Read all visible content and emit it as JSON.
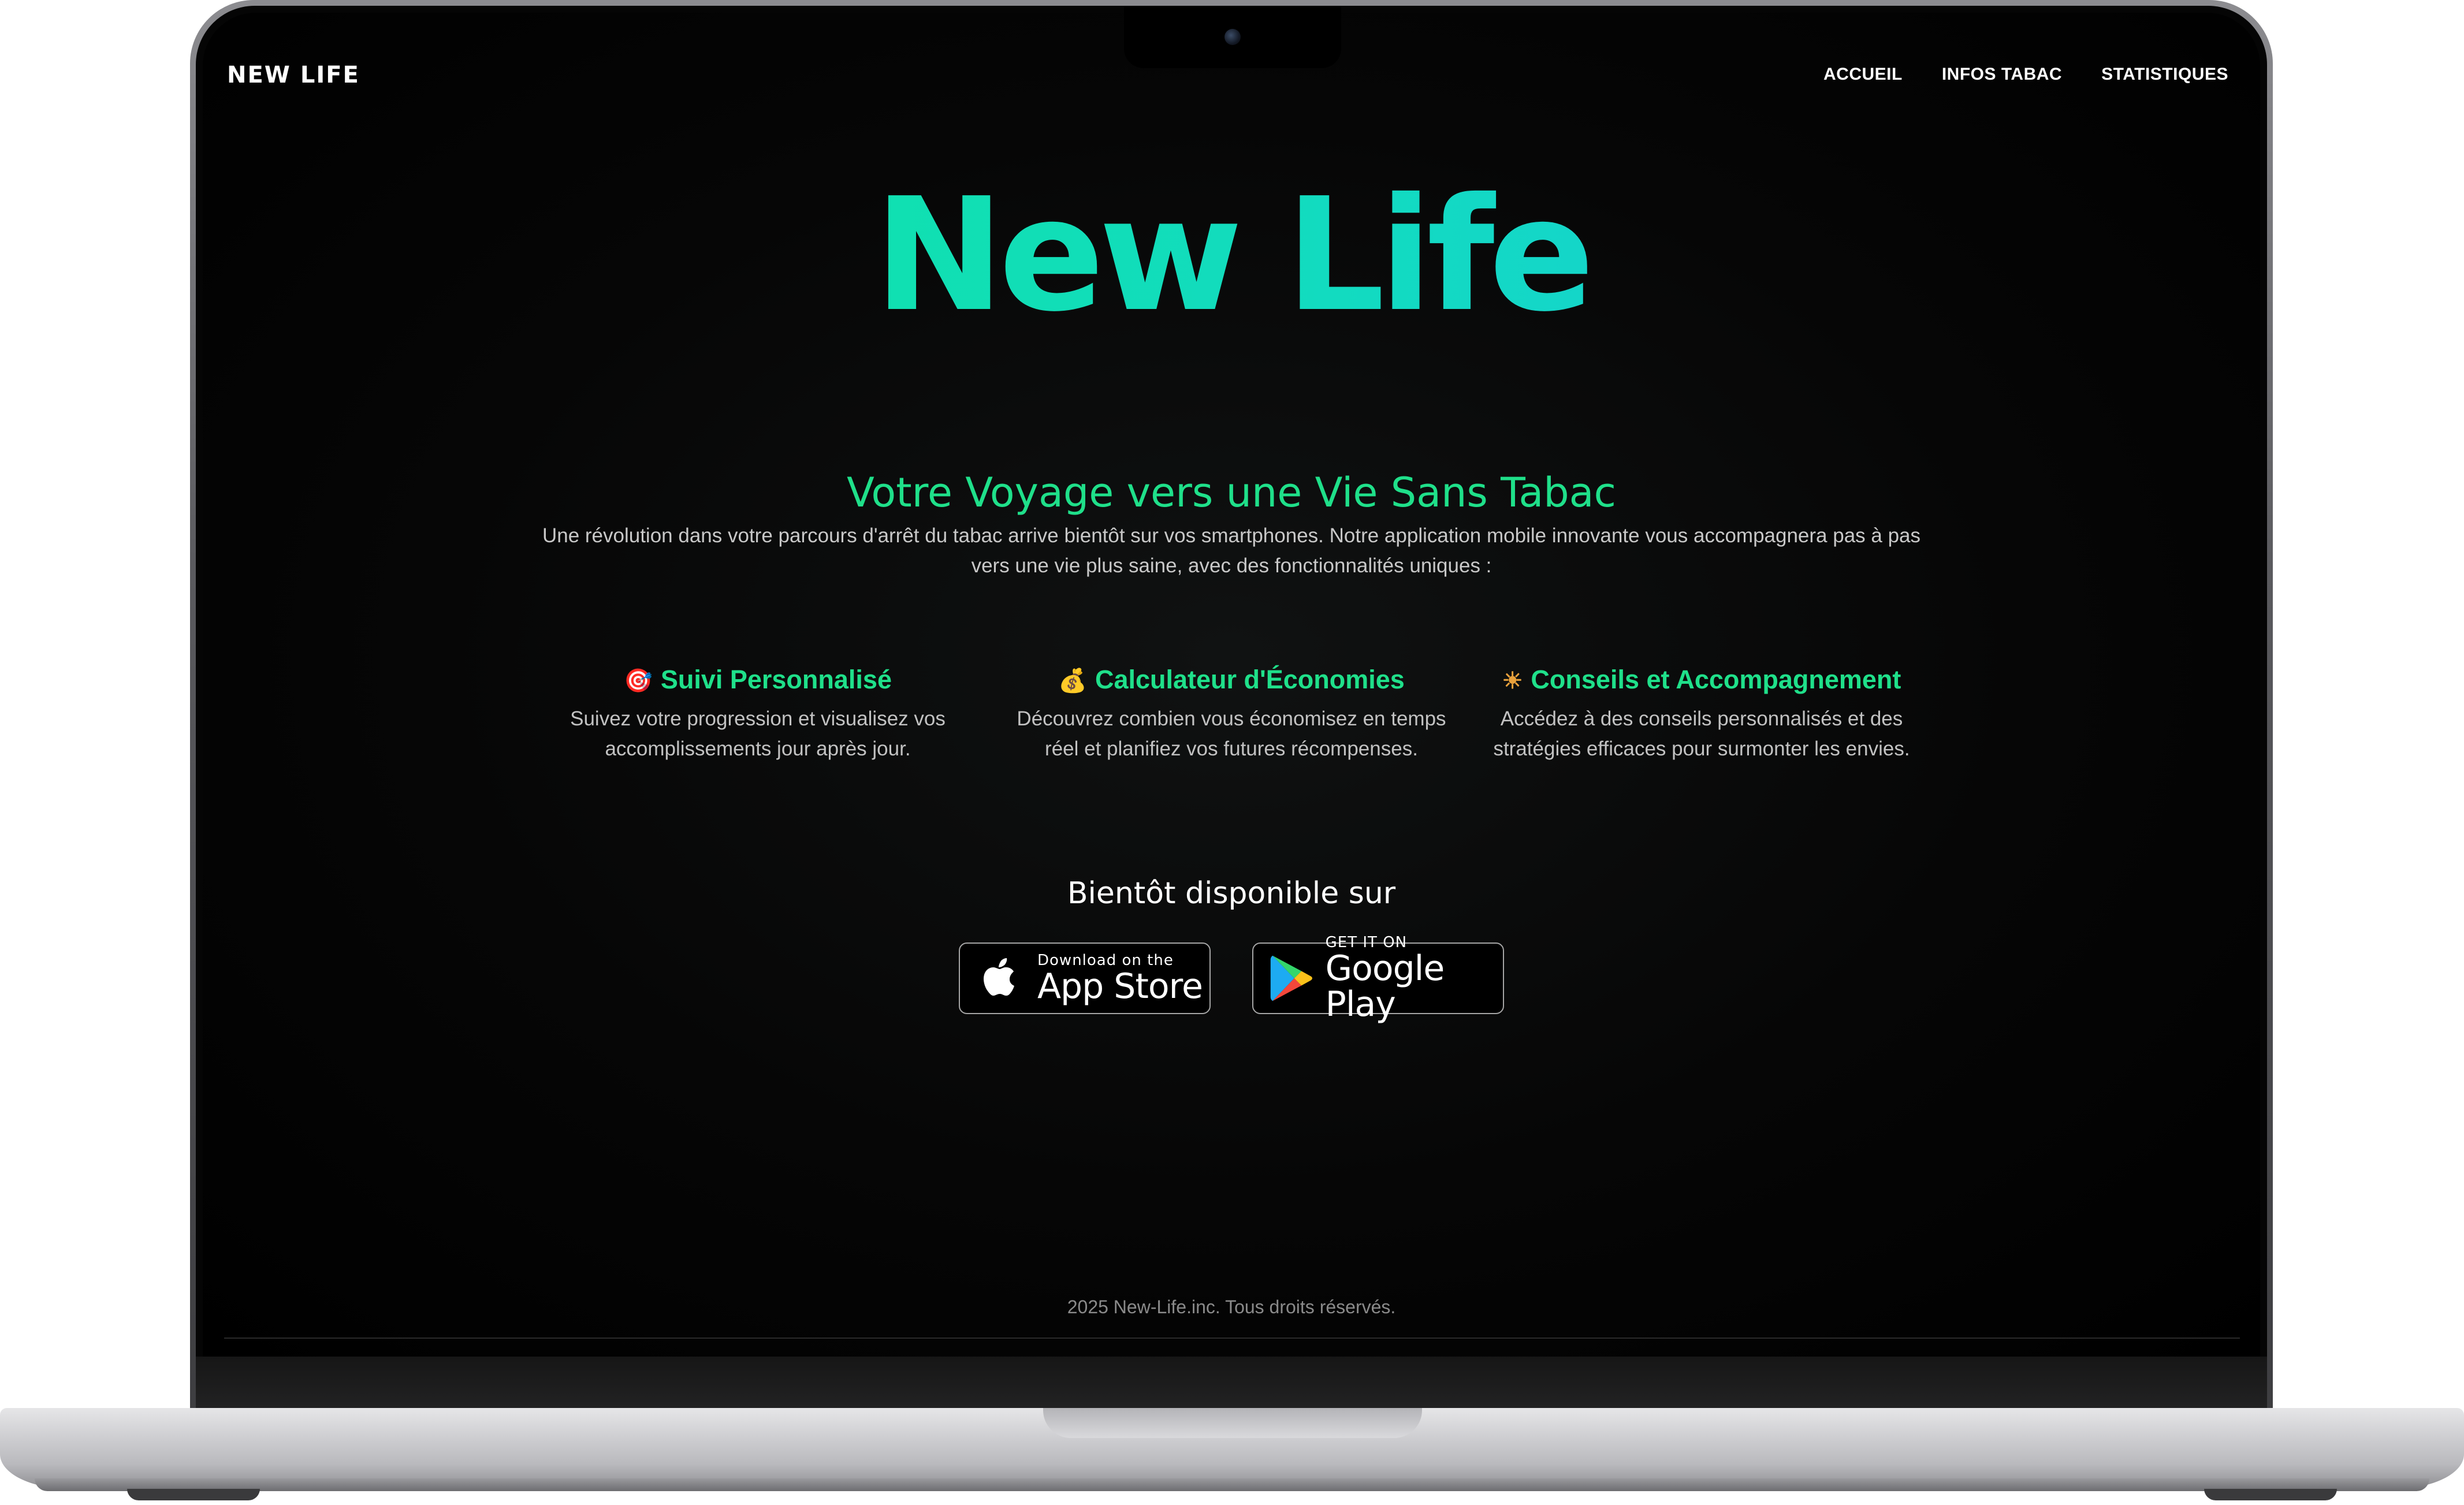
{
  "header": {
    "brand": "NEW LIFE",
    "nav": [
      {
        "label": "ACCUEIL"
      },
      {
        "label": "INFOS TABAC"
      },
      {
        "label": "STATISTIQUES"
      }
    ]
  },
  "hero": {
    "title": "New Life",
    "subtitle": "Votre Voyage vers une Vie Sans Tabac",
    "intro": "Une révolution dans votre parcours d'arrêt du tabac arrive bientôt sur vos smartphones. Notre application mobile innovante vous accompagnera pas à pas vers une vie plus saine, avec des fonctionnalités uniques :"
  },
  "features": [
    {
      "icon": "target-icon",
      "emoji": "🎯",
      "title": "Suivi Personnalisé",
      "description": "Suivez votre progression et visualisez vos accomplissements jour après jour."
    },
    {
      "icon": "money-bag-icon",
      "emoji": "💰",
      "title": "Calculateur d'Économies",
      "description": "Découvrez combien vous économisez en temps réel et planifiez vos futures récompenses."
    },
    {
      "icon": "sun-icon",
      "emoji": "☀",
      "title": "Conseils et Accompagnement",
      "description": "Accédez à des conseils personnalisés et des stratégies efficaces pour surmonter les envies."
    }
  ],
  "download": {
    "heading": "Bientôt disponible sur",
    "app_store": {
      "small": "Download on the",
      "big": "App Store"
    },
    "google_play": {
      "small": "GET IT ON",
      "big": "Google Play"
    }
  },
  "footer": {
    "copyright": "2025 New-Life.inc. Tous droits réservés."
  },
  "colors": {
    "accent_green": "#1fe08a",
    "gradient_start": "#0ee79b",
    "gradient_end": "#19c9e0",
    "background": "#000000"
  }
}
